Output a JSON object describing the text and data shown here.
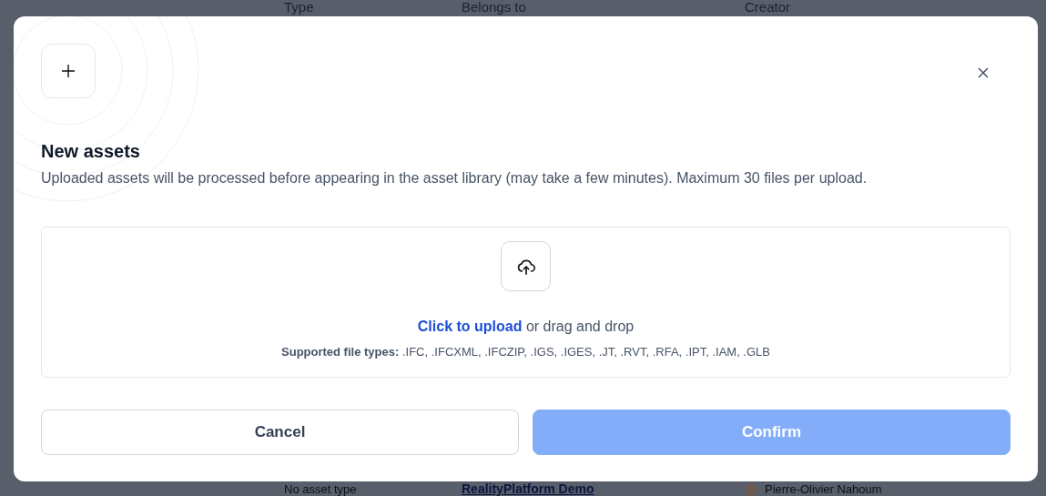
{
  "background_table": {
    "columns": [
      "Type",
      "Belongs to",
      "Creator"
    ],
    "row": {
      "type": "No asset type",
      "belongs_to": "RealityPlatform Demo",
      "creator": "Pierre-Olivier Nahoum"
    }
  },
  "modal": {
    "title": "New assets",
    "description": "Uploaded assets will be processed before appearing in the asset library (may take a few minutes). Maximum 30 files per upload.",
    "dropzone": {
      "link": "Click to upload",
      "rest": "or drag and drop",
      "supported_label": "Supported file types:",
      "supported_types": ".IFC, .IFCXML, .IFCZIP, .IGS, .IGES, .JT, .RVT, .RFA, .IPT, .IAM, .GLB"
    },
    "buttons": [
      {
        "label": "Cancel",
        "kind": "secondary",
        "disabled": false
      },
      {
        "label": "Confirm",
        "kind": "primary",
        "disabled": true
      }
    ]
  }
}
